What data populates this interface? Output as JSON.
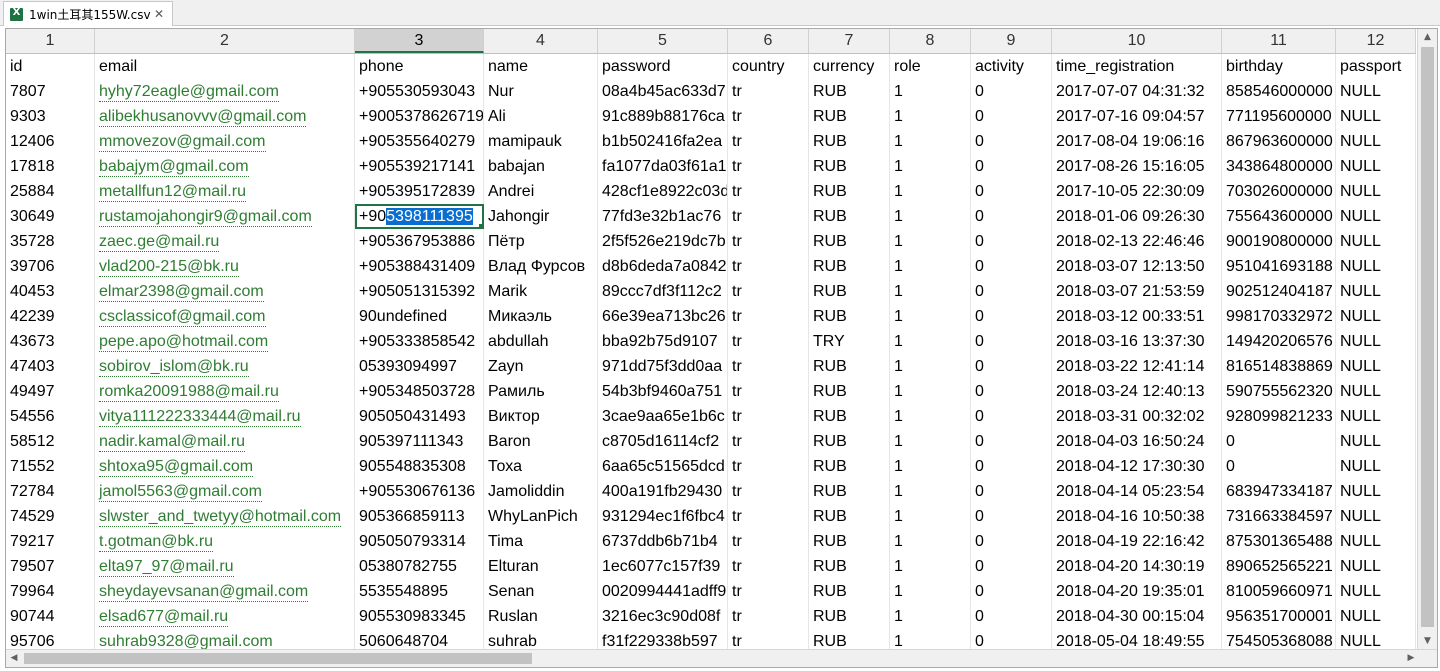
{
  "tab": {
    "label": "1win土耳其155W.csv",
    "close": "✕",
    "icon": "excel-csv-icon"
  },
  "columns": [
    "1",
    "2",
    "3",
    "4",
    "5",
    "6",
    "7",
    "8",
    "9",
    "10",
    "11",
    "12"
  ],
  "selected_column": "3",
  "headers": [
    "id",
    "email",
    "phone",
    "name",
    "password",
    "country",
    "currency",
    "role",
    "activity",
    "time_registration",
    "birthday",
    "passport"
  ],
  "rows": [
    [
      "7807",
      "hyhy72eagle@gmail.com",
      "+905530593043",
      "Nur",
      "08a4b45ac633d7",
      "tr",
      "RUB",
      "1",
      "0",
      "2017-07-07 04:31:32",
      "858546000000",
      "NULL"
    ],
    [
      "9303",
      "alibekhusanovvv@gmail.com",
      "+90053786267191",
      "Ali",
      "91c889b88176ca",
      "tr",
      "RUB",
      "1",
      "0",
      "2017-07-16 09:04:57",
      "771195600000",
      "NULL"
    ],
    [
      "12406",
      "mmovezov@gmail.com",
      "+905355640279",
      "mamipauk",
      "b1b502416fa2ea",
      "tr",
      "RUB",
      "1",
      "0",
      "2017-08-04 19:06:16",
      "867963600000",
      "NULL"
    ],
    [
      "17818",
      "babajym@gmail.com",
      "+905539217141",
      "babajan",
      "fa1077da03f61a1",
      "tr",
      "RUB",
      "1",
      "0",
      "2017-08-26 15:16:05",
      "343864800000",
      "NULL"
    ],
    [
      "25884",
      "metallfun12@mail.ru",
      "+905395172839",
      "Andrei",
      "428cf1e8922c03d",
      "tr",
      "RUB",
      "1",
      "0",
      "2017-10-05 22:30:09",
      "703026000000",
      "NULL"
    ],
    [
      "30649",
      "rustamojahongir9@gmail.com",
      "+905398111395",
      "Jahongir",
      "77fd3e32b1ac76",
      "tr",
      "RUB",
      "1",
      "0",
      "2018-01-06 09:26:30",
      "755643600000",
      "NULL"
    ],
    [
      "35728",
      "zaec.ge@mail.ru",
      "+905367953886",
      "Пётр",
      "2f5f526e219dc7b",
      "tr",
      "RUB",
      "1",
      "0",
      "2018-02-13 22:46:46",
      "900190800000",
      "NULL"
    ],
    [
      "39706",
      "vlad200-215@bk.ru",
      "+905388431409",
      "Влад Фурсов",
      "d8b6deda7a0842",
      "tr",
      "RUB",
      "1",
      "0",
      "2018-03-07 12:13:50",
      "951041693188",
      "NULL"
    ],
    [
      "40453",
      "elmar2398@gmail.com",
      "+905051315392",
      "Marik",
      "89ccc7df3f112c2",
      "tr",
      "RUB",
      "1",
      "0",
      "2018-03-07 21:53:59",
      "902512404187",
      "NULL"
    ],
    [
      "42239",
      "csclassicof@gmail.com",
      "90undefined",
      "Микаэль",
      "66e39ea713bc26",
      "tr",
      "RUB",
      "1",
      "0",
      "2018-03-12 00:33:51",
      "998170332972",
      "NULL"
    ],
    [
      "43673",
      "pepe.apo@hotmail.com",
      "+905333858542",
      "abdullah",
      "bba92b75d9107",
      "tr",
      "TRY",
      "1",
      "0",
      "2018-03-16 13:37:30",
      "149420206576",
      "NULL"
    ],
    [
      "47403",
      "sobirov_islom@bk.ru",
      "05393094997",
      "Zayn",
      "971dd75f3dd0aa",
      "tr",
      "RUB",
      "1",
      "0",
      "2018-03-22 12:41:14",
      "816514838869",
      "NULL"
    ],
    [
      "49497",
      "romka20091988@mail.ru",
      "+905348503728",
      "Рамиль",
      "54b3bf9460a751",
      "tr",
      "RUB",
      "1",
      "0",
      "2018-03-24 12:40:13",
      "590755562320",
      "NULL"
    ],
    [
      "54556",
      "vitya111222333444@mail.ru",
      "905050431493",
      "Виктор",
      "3cae9aa65e1b6c",
      "tr",
      "RUB",
      "1",
      "0",
      "2018-03-31 00:32:02",
      "928099821233",
      "NULL"
    ],
    [
      "58512",
      "nadir.kamal@mail.ru",
      "905397111343",
      "Baron",
      "c8705d16114cf2",
      "tr",
      "RUB",
      "1",
      "0",
      "2018-04-03 16:50:24",
      "0",
      "NULL"
    ],
    [
      "71552",
      "shtoxa95@gmail.com",
      "905548835308",
      "Тоха",
      "6aa65c51565dcd",
      "tr",
      "RUB",
      "1",
      "0",
      "2018-04-12 17:30:30",
      "0",
      "NULL"
    ],
    [
      "72784",
      "jamol5563@gmail.com",
      "+905530676136",
      "Jamoliddin",
      "400a191fb29430",
      "tr",
      "RUB",
      "1",
      "0",
      "2018-04-14 05:23:54",
      "683947334187",
      "NULL"
    ],
    [
      "74529",
      "slwster_and_twetyy@hotmail.com",
      "905366859113",
      "WhyLanPich",
      "931294ec1f6fbc4",
      "tr",
      "RUB",
      "1",
      "0",
      "2018-04-16 10:50:38",
      "731663384597",
      "NULL"
    ],
    [
      "79217",
      "t.gotman@bk.ru",
      "905050793314",
      "Tima",
      "6737ddb6b71b4",
      "tr",
      "RUB",
      "1",
      "0",
      "2018-04-19 22:16:42",
      "875301365488",
      "NULL"
    ],
    [
      "79507",
      "elta97_97@mail.ru",
      "05380782755",
      "Elturan",
      "1ec6077c157f39",
      "tr",
      "RUB",
      "1",
      "0",
      "2018-04-20 14:30:19",
      "890652565221",
      "NULL"
    ],
    [
      "79964",
      "sheydayevsanan@gmail.com",
      "5535548895",
      "Senan",
      "0020994441adff9",
      "tr",
      "RUB",
      "1",
      "0",
      "2018-04-20 19:35:01",
      "810059660971",
      "NULL"
    ],
    [
      "90744",
      "elsad677@mail.ru",
      "905530983345",
      "Ruslan",
      "3216ec3c90d08f",
      "tr",
      "RUB",
      "1",
      "0",
      "2018-04-30 00:15:04",
      "956351700001",
      "NULL"
    ],
    [
      "95706",
      "suhrab9328@gmail.com",
      "5060648704",
      "suhrab",
      "f31f229338b597",
      "tr",
      "RUB",
      "1",
      "0",
      "2018-05-04 18:49:55",
      "754505368088",
      "NULL"
    ]
  ],
  "active_cell": {
    "row": 5,
    "col": 2,
    "prefix": "+90",
    "selected_text": "5398111395"
  }
}
